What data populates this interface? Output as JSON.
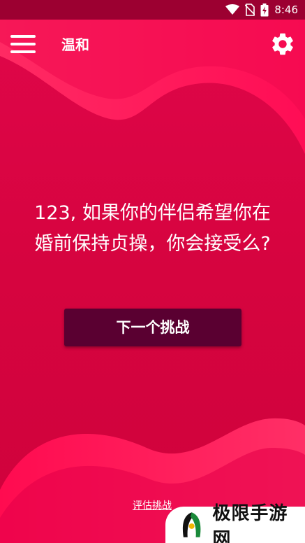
{
  "status_bar": {
    "time": "8:46",
    "icons": [
      "wifi-icon",
      "no-sim-icon",
      "battery-charging-icon"
    ]
  },
  "app_bar": {
    "title": "温和",
    "menu_icon": "hamburger-menu-icon",
    "settings_icon": "gear-icon"
  },
  "question": {
    "line1": "123, 如果你的伴侣希望你在",
    "line2": "婚前保持贞操，你会接受么?"
  },
  "next_button": {
    "label": "下一个挑战"
  },
  "footer": {
    "rate_link": "评估挑战"
  },
  "watermark": {
    "text": "极限手游网"
  },
  "colors": {
    "background": "#e0064a",
    "wave_light": "#ff1f5e",
    "button": "#5a0031",
    "status_bar": "#9c0031"
  }
}
